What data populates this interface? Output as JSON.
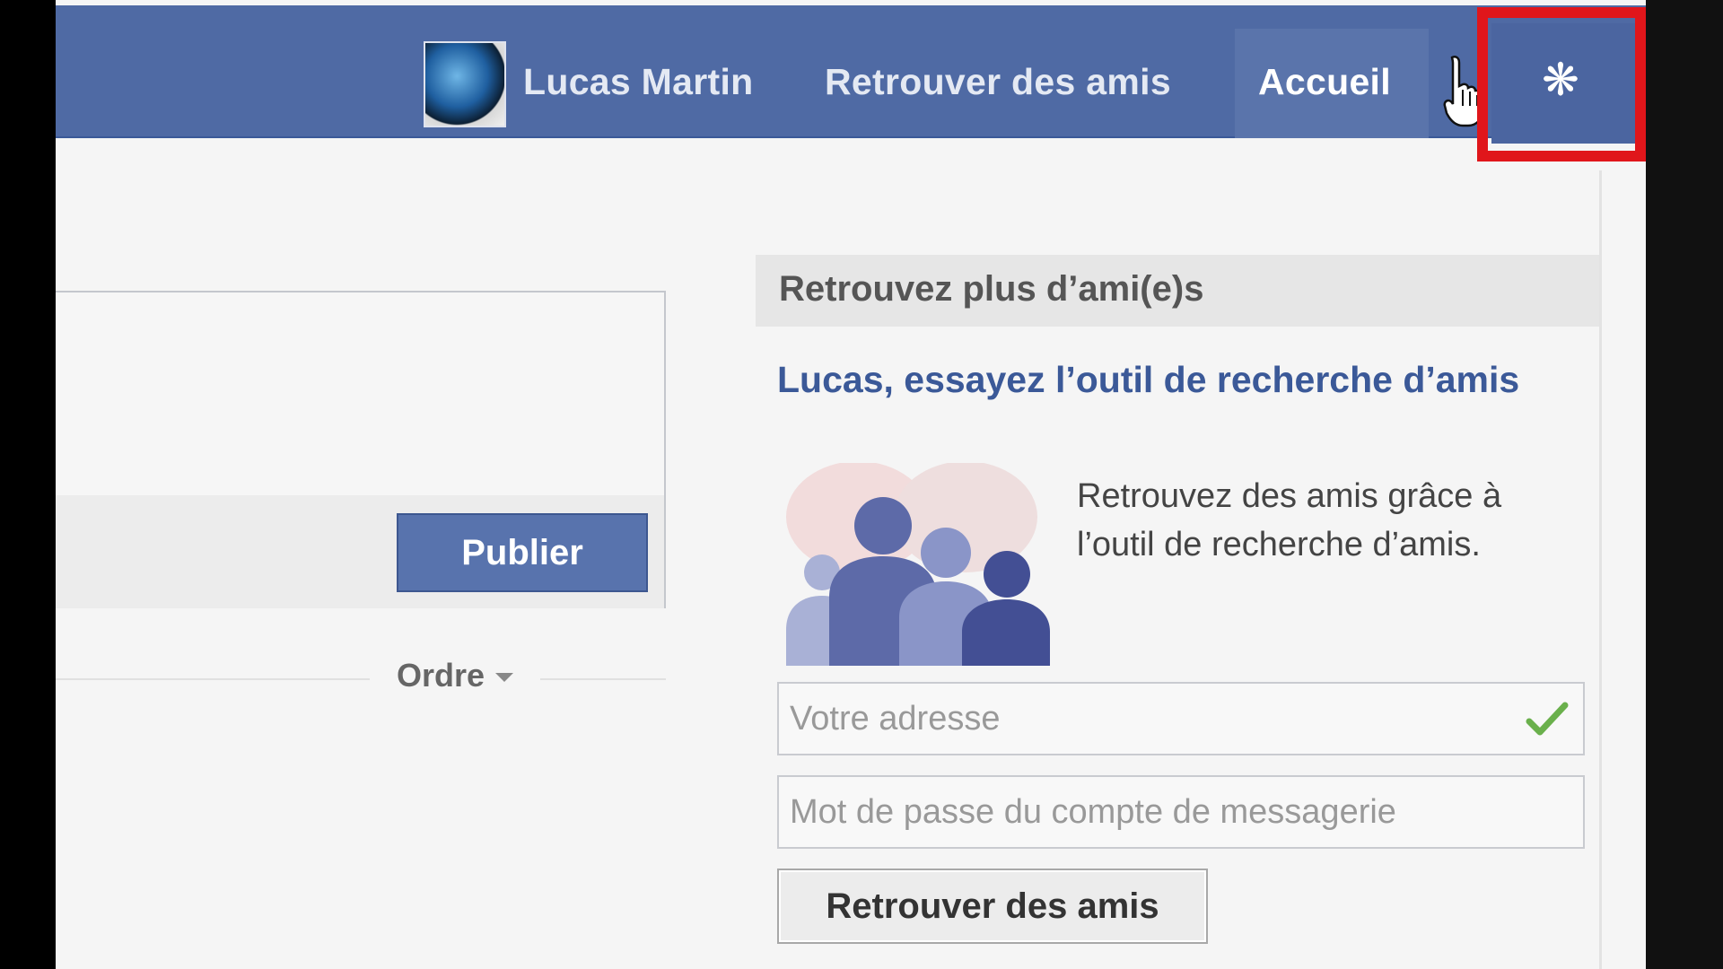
{
  "header": {
    "profile_name": "Lucas Martin",
    "find_friends": "Retrouver des amis",
    "home": "Accueil",
    "gear_icon": "gear-icon"
  },
  "composer": {
    "publish_label": "Publier",
    "order_label": "Ordre"
  },
  "friend_finder": {
    "title": "Retrouvez plus d’ami(e)s",
    "link": "Lucas, essayez l’outil de recherche d’amis",
    "description": "Retrouvez des amis grâce à l’outil de recherche d’amis.",
    "email_placeholder": "Votre adresse",
    "password_placeholder": "Mot de passe du compte de messagerie",
    "button_label": "Retrouver des amis"
  },
  "colors": {
    "topbar": "#4f6aa4",
    "highlight": "#e0161b",
    "link": "#3b5998"
  }
}
